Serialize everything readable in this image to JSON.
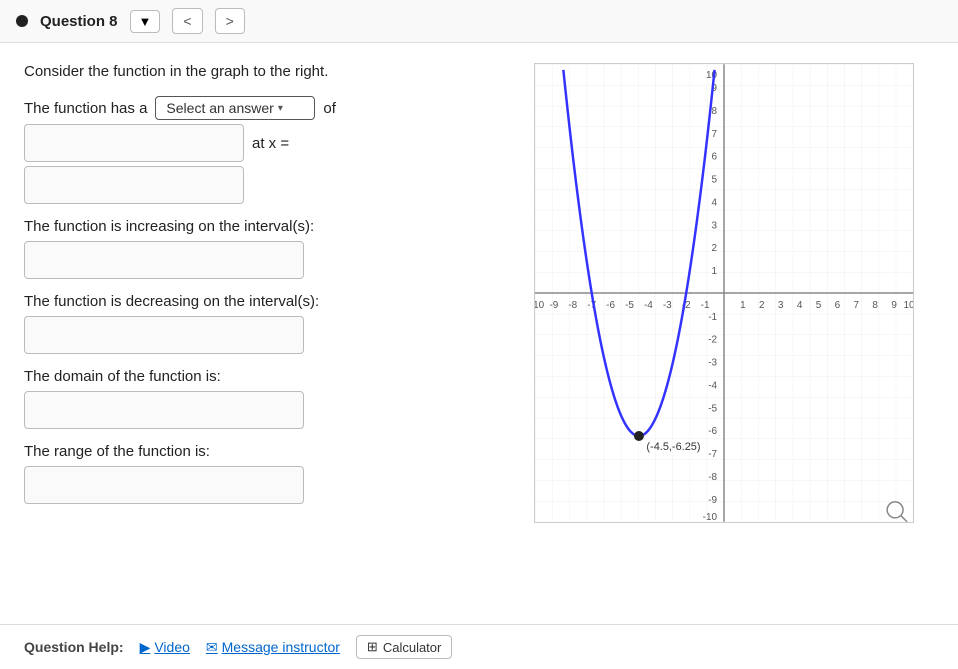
{
  "header": {
    "question_label": "Question 8",
    "dropdown_label": "▼",
    "prev_label": "<",
    "next_label": ">"
  },
  "main": {
    "intro": "Consider the function in the graph to the right.",
    "has_a": "The function has a",
    "select_placeholder": "Select an answer",
    "of_label": "of",
    "at_x_label": "at x =",
    "input1_placeholder": "",
    "input2_placeholder": "",
    "increasing_label": "The function is increasing on the interval(s):",
    "increasing_placeholder": "",
    "decreasing_label": "The function is decreasing on the interval(s):",
    "decreasing_placeholder": "",
    "domain_label": "The domain of the function is:",
    "domain_placeholder": "",
    "range_label": "The range of the function is:",
    "range_placeholder": ""
  },
  "footer": {
    "help_label": "Question Help:",
    "video_label": "Video",
    "message_label": "Message instructor",
    "calculator_label": "Calculator"
  },
  "graph": {
    "min_x": -10,
    "max_x": 10,
    "min_y": -10,
    "max_y": 10,
    "vertex_x": -4.5,
    "vertex_y": -6.25,
    "vertex_label": "(-4.5,-6.25)"
  }
}
